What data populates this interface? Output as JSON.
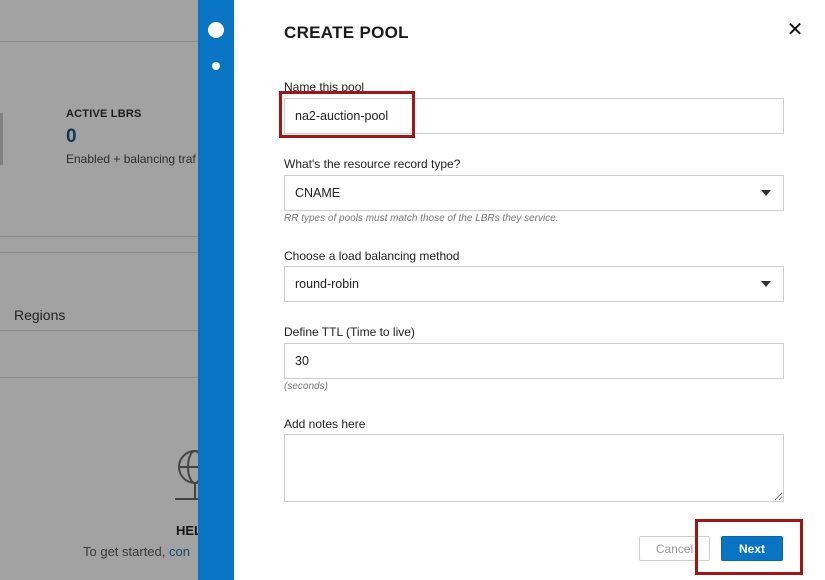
{
  "background": {
    "stat_label": "ACTIVE LBRS",
    "stat_value": "0",
    "stat_desc": "Enabled + balancing traf",
    "regions_label": "Regions",
    "empty_title": "HEL",
    "empty_text_prefix": "To get started, ",
    "empty_text_link": "con"
  },
  "dialog": {
    "title": "CREATE POOL",
    "close_icon": "close-icon",
    "close_glyph": "✕",
    "fields": {
      "name": {
        "label": "Name this pool",
        "value": "na2-auction-pool"
      },
      "rr_type": {
        "label": "What's the resource record type?",
        "value": "CNAME",
        "hint": "RR types of pools must match those of the LBRs they service."
      },
      "lb_method": {
        "label": "Choose a load balancing method",
        "value": "round-robin"
      },
      "ttl": {
        "label": "Define TTL (Time to live)",
        "value": "30",
        "hint": "(seconds)"
      },
      "notes": {
        "label": "Add notes here",
        "value": ""
      }
    },
    "buttons": {
      "cancel": "Cancel",
      "next": "Next"
    }
  },
  "colors": {
    "accent": "#0a74c4",
    "highlight": "#a31414"
  }
}
